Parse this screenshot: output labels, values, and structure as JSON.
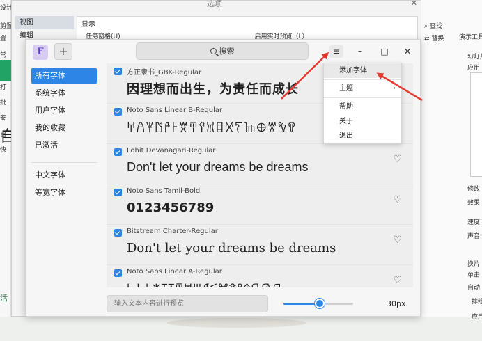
{
  "background": {
    "left_fragments": [
      "设计",
      "剪置",
      "置",
      "常",
      "音",
      "打",
      "批",
      "安",
      "自",
      "快"
    ],
    "left_glyph": "自",
    "left_stamp": "活",
    "dialog": {
      "title": "选项",
      "sidebar_items": [
        "视图",
        "编辑"
      ],
      "section_title": "显示",
      "row1_left": "任务窗格(U)",
      "row1_right": "启用实时预览（L）"
    },
    "right_panel": {
      "find_label": "查找",
      "replace_label": "替换",
      "present_tools": "演示工具",
      "texts": [
        "幻灯片",
        "应用",
        "修改",
        "效果",
        "速度:",
        "声音:",
        "换片",
        "单击",
        "自动",
        "排练",
        "应用"
      ]
    }
  },
  "app": {
    "logo_letter": "F",
    "add_button_label": "+",
    "search_label": "搜索",
    "window_buttons": {
      "menu": "≡",
      "minimize": "–",
      "maximize": "□",
      "close": "✕"
    }
  },
  "sidebar": {
    "group1": [
      "所有字体",
      "系统字体",
      "用户字体",
      "我的收藏",
      "已激活"
    ],
    "group2": [
      "中文字体",
      "等宽字体"
    ]
  },
  "fonts": [
    {
      "name": "方正隶书_GBK-Regular",
      "sample": "因理想而出生，为责任而成长"
    },
    {
      "name": "Noto Sans Linear B-Regular",
      "sample": "𐀀𐀁𐀂𐀃𐀄𐀅𐀆𐀇𐀈𐀉𐀊𐀋𐀍𐀎𐀏𐀐𐀑𐀒"
    },
    {
      "name": "Lohit Devanagari-Regular",
      "sample": "Don't let your dreams be dreams"
    },
    {
      "name": "Noto Sans Tamil-Bold",
      "sample": "0123456789"
    },
    {
      "name": "Bitstream Charter-Regular",
      "sample": "Don't let your dreams be dreams"
    },
    {
      "name": "Noto Sans Linear A-Regular",
      "sample": "𐘀𐘁𐘂𐘃𐘄𐘅𐘆𐘇𐘈𐘉𐘊𐘋𐘌𐘍𐘎𐘏𐘐𐘑"
    }
  ],
  "footer": {
    "preview_placeholder": "输入文本内容进行预览",
    "font_size_value": 30,
    "font_size_label": "30px",
    "slider_fraction": 0.52
  },
  "menu": {
    "items": [
      "添加字体",
      "主题",
      "帮助",
      "关于",
      "退出"
    ]
  },
  "colors": {
    "accent": "#2d86e6",
    "arrow": "#e53a32"
  }
}
